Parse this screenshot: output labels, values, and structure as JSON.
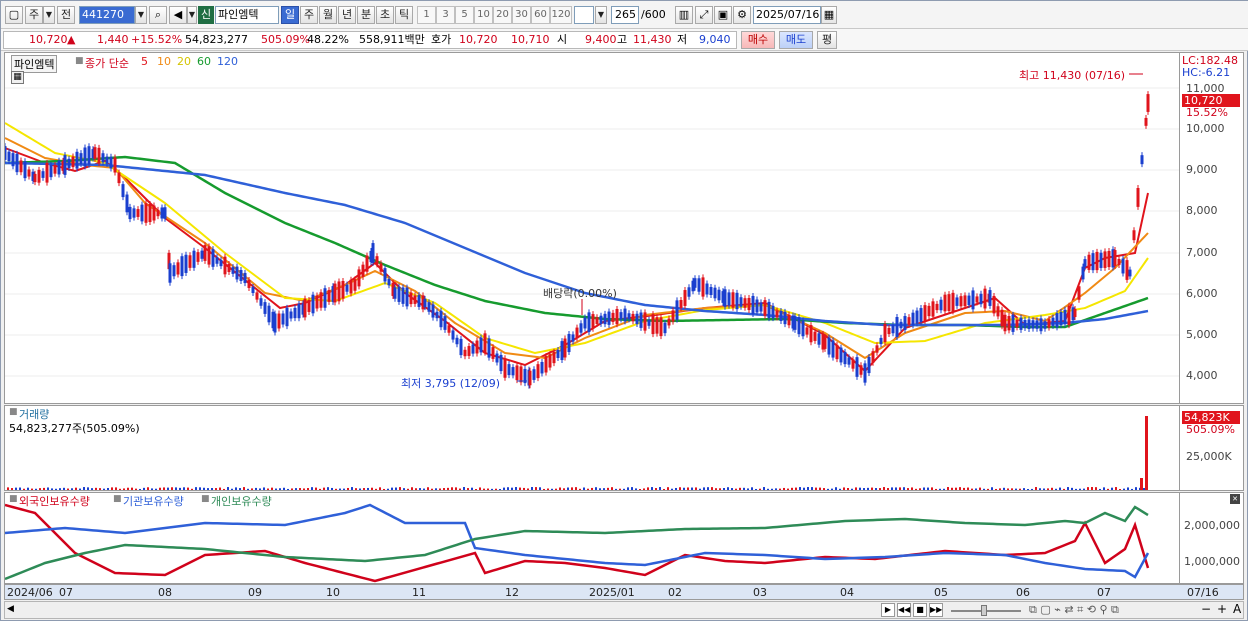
{
  "toolbar": {
    "period_unit": "주",
    "prev_label": "전",
    "code_value": "441270",
    "new_badge": "신",
    "stock_name": "파인엠텍",
    "tab_day": "일",
    "tab_week": "주",
    "tab_month": "월",
    "tab_year": "년",
    "tab_minute": "분",
    "tab_second": "초",
    "tab_tick": "틱",
    "numbers": [
      "1",
      "3",
      "5",
      "10",
      "20",
      "30",
      "60",
      "120"
    ],
    "count_value": "265",
    "count_total": "/600",
    "date_value": "2025/07/16"
  },
  "quote": {
    "price": "10,720",
    "arrow": "▲",
    "change": "1,440",
    "change_pct": "+15.52%",
    "volume": "54,823,277",
    "volume_ratio": "505.09%",
    "turnover": "48.22%",
    "amount": "558,911백만",
    "bid_label": "호가",
    "bid1": "10,720",
    "bid2": "10,710",
    "open_label": "시",
    "open": "9,400",
    "high_label": "고",
    "high": "11,430",
    "low_label": "저",
    "low": "9,040",
    "buy_label": "매수",
    "sell_label": "매도",
    "avg_label": "평"
  },
  "price_panel": {
    "name": "파인엠텍",
    "legend_title": "종가 단순",
    "ma": [
      {
        "period": "5",
        "color": "#e0141c"
      },
      {
        "period": "10",
        "color": "#f08a14"
      },
      {
        "period": "20",
        "color": "#f5e600"
      },
      {
        "period": "60",
        "color": "#169b2e"
      },
      {
        "period": "120",
        "color": "#2f60d8"
      }
    ],
    "max_annot": "최고 11,430 (07/16)",
    "min_annot": "최저 3,795 (12/09)",
    "dividend_annot": "배당락(0.00%)",
    "lc": "LC:182.48",
    "hc": "HC:-6.21",
    "cur_price_tag": "10,720",
    "cur_pct_tag": "15.52%",
    "y_ticks": [
      "11,000",
      "10,000",
      "9,000",
      "8,000",
      "7,000",
      "6,000",
      "5,000",
      "4,000"
    ]
  },
  "volume_panel": {
    "title": "거래량",
    "value": "54,823,277주(505.09%)",
    "tag": "54,823K",
    "tag_pct": "505.09%",
    "tick": "25,000K"
  },
  "holdings_panel": {
    "series": [
      {
        "name": "외국인보유수량",
        "color": "#d0021b"
      },
      {
        "name": "기관보유수량",
        "color": "#2f60d8"
      },
      {
        "name": "개인보유수량",
        "color": "#2e8b57"
      }
    ],
    "ticks": [
      "2,000,000",
      "1,000,000"
    ]
  },
  "x_labels": [
    "2024/06",
    "07",
    "08",
    "09",
    "10",
    "11",
    "12",
    "2025/01",
    "02",
    "03",
    "04",
    "05",
    "06",
    "07"
  ],
  "x_end_label": "07/16"
}
